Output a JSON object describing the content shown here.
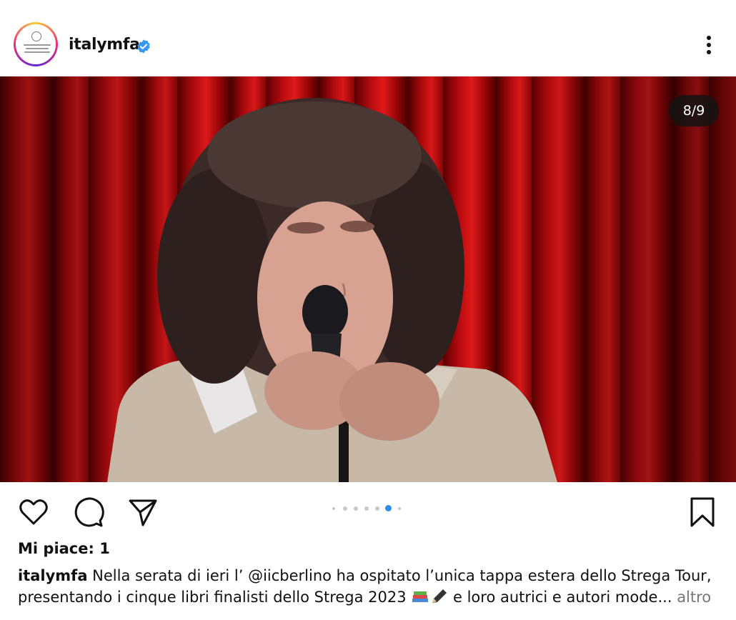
{
  "post": {
    "username": "italymfa",
    "verified_icon": "verified-badge-icon",
    "menu_icon": "more-vertical-icon",
    "image_counter": "8/9",
    "carousel": {
      "total": 9,
      "current": 8
    }
  },
  "actions": {
    "like_icon": "heart-icon",
    "comment_icon": "comment-icon",
    "share_icon": "send-icon",
    "save_icon": "bookmark-icon"
  },
  "likes": "Mi piace: 1",
  "caption": {
    "username": "italymfa",
    "line1": "Nella serata di ieri l’ @iicberlino ha ospitato l’unica tappa estera dello Strega Tour,",
    "line2_start": "presentando i cinque libri finalisti dello Strega 2023",
    "line2_end": "e loro autrici e autori mode...",
    "more": "altro"
  },
  "colors": {
    "accent": "#2c8df0",
    "verified": "#3897f0",
    "curtain": "#c0101a"
  }
}
